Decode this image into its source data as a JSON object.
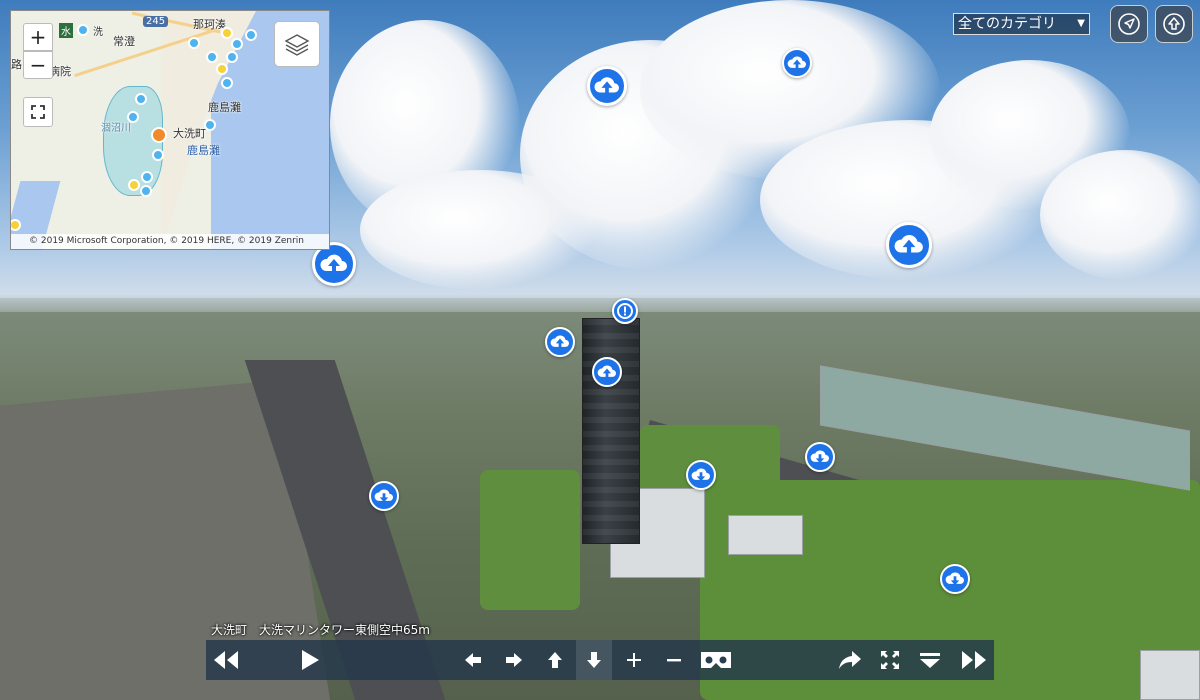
{
  "map": {
    "zoom_in_label": "+",
    "zoom_out_label": "−",
    "attribution": "© 2019 Microsoft Corporation, © 2019 HERE, © 2019 Zenrin",
    "labels": {
      "mito": "水",
      "oarai_top": "洗",
      "route245": "245",
      "naka": "那珂湊",
      "hitachi": "常澄",
      "hospital": "ケ崎病院",
      "road": "路",
      "kashimanada1": "鹿島灘",
      "oarai": "大洗町",
      "hinuma": "涸沼川",
      "kashimanada2": "鹿島灘"
    }
  },
  "category": {
    "selected": "全てのカテゴリ",
    "caret": "▼"
  },
  "caption": "大洗町　大洗マリンタワー東側空中65m",
  "icons": {
    "navigate": "navigation-arrow-icon",
    "up": "up-arrow-icon",
    "info": "info-icon",
    "cloud_up": "cloud-upload-icon",
    "cloud_down": "cloud-download-icon"
  },
  "colors": {
    "hotspot": "#1e73e8",
    "toolbar": "#23374b"
  }
}
